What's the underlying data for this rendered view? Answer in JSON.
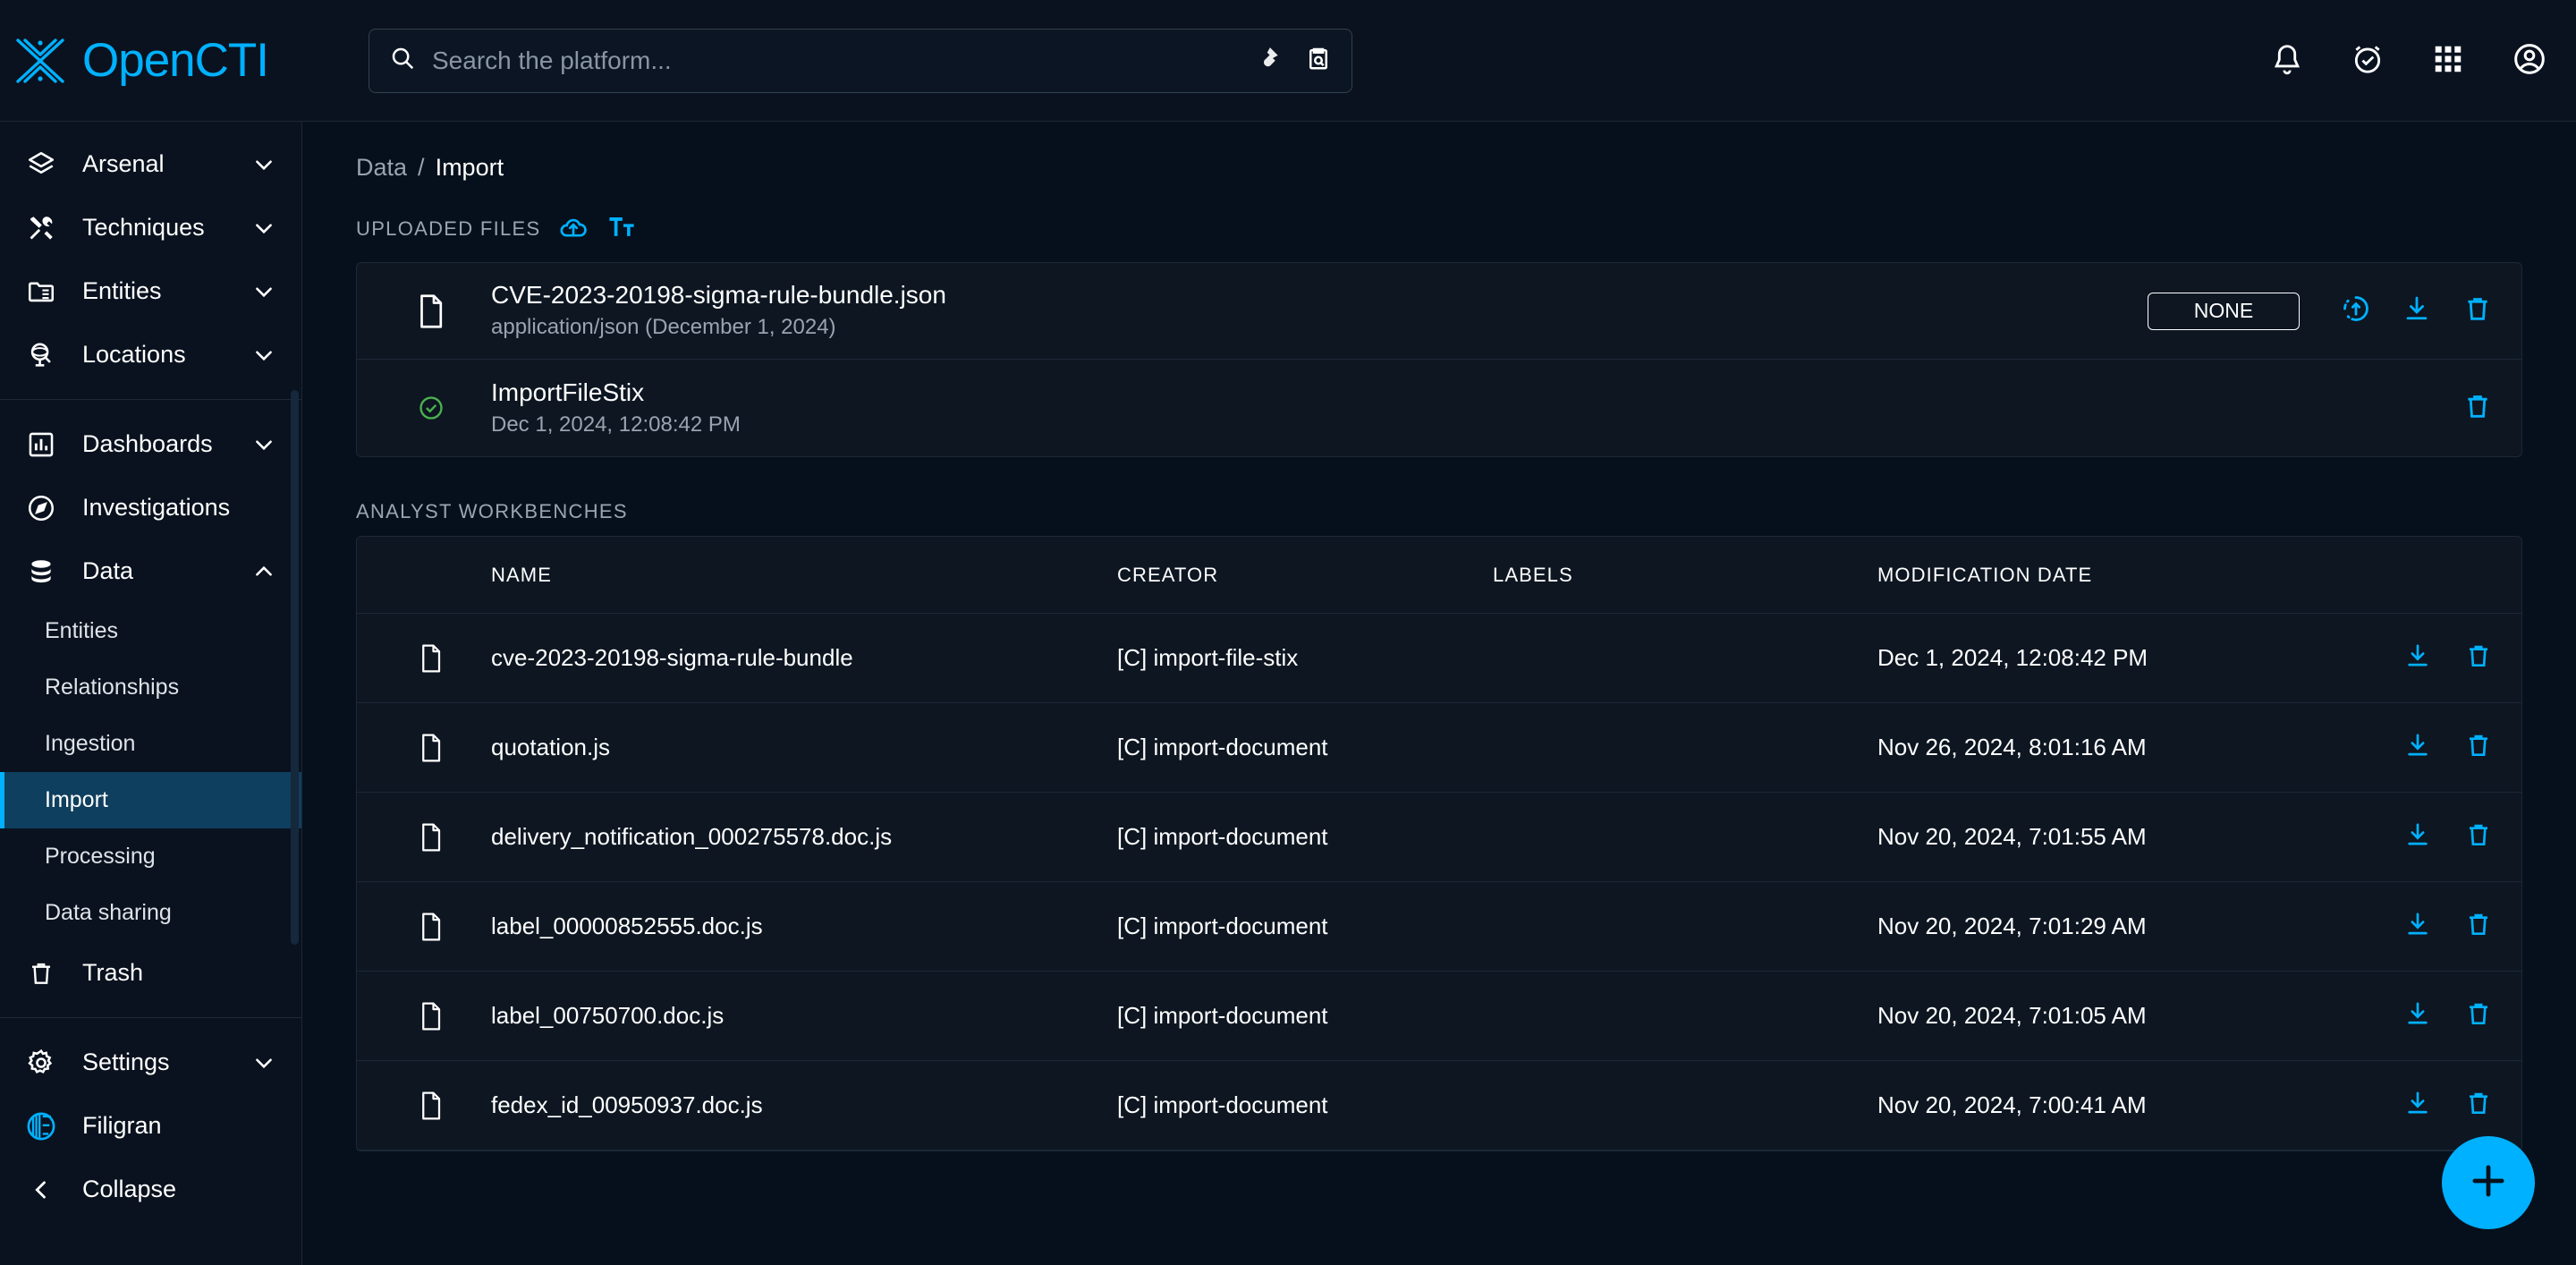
{
  "brand": {
    "name": "OpenCTI",
    "logo_icon": "opencti-logo-icon",
    "accent": "#00b1ff"
  },
  "search": {
    "placeholder": "Search the platform...",
    "value": "",
    "icon": "search-icon",
    "trailing_icons": [
      "ink-drop-icon",
      "clipboard-search-icon"
    ]
  },
  "topbar_actions": [
    {
      "name": "notifications-bell-icon",
      "icon": "bell-icon"
    },
    {
      "name": "alarm-check-icon",
      "icon": "alarm-check-icon"
    },
    {
      "name": "apps-grid-icon",
      "icon": "apps-grid-icon"
    },
    {
      "name": "account-circle-icon",
      "icon": "account-circle-icon"
    }
  ],
  "sidebar": {
    "group1": [
      {
        "label": "Arsenal",
        "icon": "layers-icon",
        "expandable": true,
        "expanded": false
      },
      {
        "label": "Techniques",
        "icon": "tools-icon",
        "expandable": true,
        "expanded": false
      },
      {
        "label": "Entities",
        "icon": "folder-list-icon",
        "expandable": true,
        "expanded": false
      },
      {
        "label": "Locations",
        "icon": "globe-stand-icon",
        "expandable": true,
        "expanded": false
      }
    ],
    "group2": [
      {
        "label": "Dashboards",
        "icon": "bar-chart-icon",
        "expandable": true,
        "expanded": false
      },
      {
        "label": "Investigations",
        "icon": "compass-icon",
        "expandable": false,
        "expanded": false
      },
      {
        "label": "Data",
        "icon": "database-icon",
        "expandable": true,
        "expanded": true
      }
    ],
    "data_children": [
      {
        "label": "Entities",
        "active": false
      },
      {
        "label": "Relationships",
        "active": false
      },
      {
        "label": "Ingestion",
        "active": false
      },
      {
        "label": "Import",
        "active": true
      },
      {
        "label": "Processing",
        "active": false
      },
      {
        "label": "Data sharing",
        "active": false
      }
    ],
    "group3": [
      {
        "label": "Trash",
        "icon": "trash-icon",
        "expandable": false,
        "expanded": false
      }
    ],
    "group4": [
      {
        "label": "Settings",
        "icon": "gear-icon",
        "expandable": true,
        "expanded": false
      },
      {
        "label": "Filigran",
        "icon": "filigran-icon",
        "expandable": false,
        "expanded": false
      },
      {
        "label": "Collapse",
        "icon": "chevron-left-icon",
        "expandable": false,
        "expanded": false
      }
    ]
  },
  "breadcrumb": {
    "parent": "Data",
    "separator": "/",
    "current": "Import"
  },
  "uploaded_files": {
    "title": "UPLOADED FILES",
    "actions": [
      "cloud-upload-icon",
      "text-format-icon"
    ],
    "file": {
      "name": "CVE-2023-20198-sigma-rule-bundle.json",
      "meta": "application/json (December 1, 2024)",
      "marking": "NONE",
      "icon": "file-icon",
      "row_actions": [
        "refresh-upload-icon",
        "download-icon",
        "delete-icon"
      ]
    },
    "job": {
      "name": "ImportFileStix",
      "timestamp": "Dec 1, 2024, 12:08:42 PM",
      "status_icon": "check-circle-icon",
      "status_color": "#4caf50",
      "row_actions": [
        "delete-icon"
      ]
    }
  },
  "workbenches": {
    "title": "ANALYST WORKBENCHES",
    "columns": [
      "NAME",
      "CREATOR",
      "LABELS",
      "MODIFICATION DATE"
    ],
    "rows": [
      {
        "icon": "file-icon",
        "name": "cve-2023-20198-sigma-rule-bundle",
        "creator": "[C] import-file-stix",
        "labels": "",
        "date": "Dec 1, 2024, 12:08:42 PM"
      },
      {
        "icon": "file-icon",
        "name": "quotation.js",
        "creator": "[C] import-document",
        "labels": "",
        "date": "Nov 26, 2024, 8:01:16 AM"
      },
      {
        "icon": "file-icon",
        "name": "delivery_notification_000275578.doc.js",
        "creator": "[C] import-document",
        "labels": "",
        "date": "Nov 20, 2024, 7:01:55 AM"
      },
      {
        "icon": "file-icon",
        "name": "label_00000852555.doc.js",
        "creator": "[C] import-document",
        "labels": "",
        "date": "Nov 20, 2024, 7:01:29 AM"
      },
      {
        "icon": "file-icon",
        "name": "label_00750700.doc.js",
        "creator": "[C] import-document",
        "labels": "",
        "date": "Nov 20, 2024, 7:01:05 AM"
      },
      {
        "icon": "file-icon",
        "name": "fedex_id_00950937.doc.js",
        "creator": "[C] import-document",
        "labels": "",
        "date": "Nov 20, 2024, 7:00:41 AM"
      }
    ],
    "row_actions": [
      "download-icon",
      "delete-icon"
    ]
  },
  "fab": {
    "icon": "plus-icon",
    "label": "+"
  }
}
